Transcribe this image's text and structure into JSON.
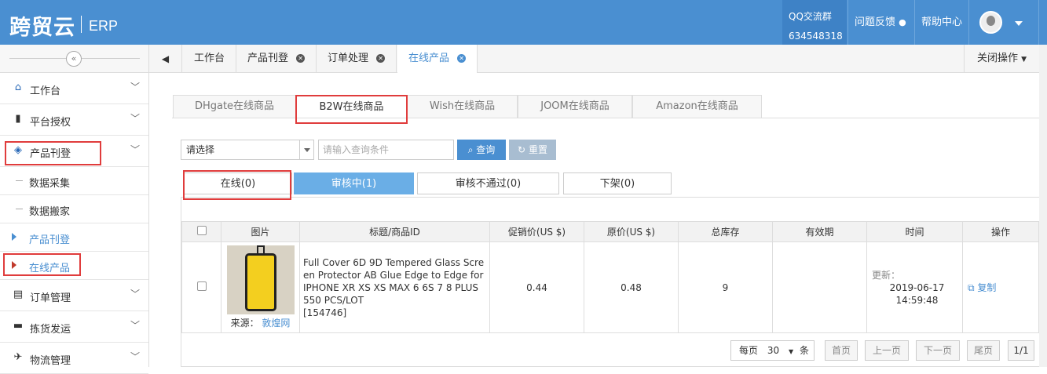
{
  "header": {
    "logo": "跨贸云",
    "product": "ERP",
    "qq_label": "QQ交流群",
    "qq_number": "634548318",
    "feedback": "问题反馈",
    "help": "帮助中心"
  },
  "sidebar": {
    "items": [
      {
        "label": "工作台"
      },
      {
        "label": "平台授权"
      },
      {
        "label": "产品刊登"
      },
      {
        "label": "数据采集"
      },
      {
        "label": "数据搬家"
      },
      {
        "label": "产品刊登"
      },
      {
        "label": "在线产品"
      },
      {
        "label": "订单管理"
      },
      {
        "label": "拣货发运"
      },
      {
        "label": "物流管理"
      }
    ]
  },
  "page_tabs": [
    {
      "label": "工作台"
    },
    {
      "label": "产品刊登"
    },
    {
      "label": "订单处理"
    },
    {
      "label": "在线产品"
    }
  ],
  "close_ops": "关闭操作",
  "platform_tabs": [
    "DHgate在线商品",
    "B2W在线商品",
    "Wish在线商品",
    "JOOM在线商品",
    "Amazon在线商品"
  ],
  "search": {
    "select_value": "请选择",
    "placeholder": "请输入查询条件",
    "query_label": "查询",
    "reset_label": "重置"
  },
  "status_tabs": [
    "在线(0)",
    "审核中(1)",
    "审核不通过(0)",
    "下架(0)"
  ],
  "table": {
    "headers": [
      "图片",
      "标题/商品ID",
      "促销价(US $)",
      "原价(US $)",
      "总库存",
      "有效期",
      "时间",
      "操作"
    ],
    "rows": [
      {
        "source_label": "来源：",
        "source_link": "敦煌网",
        "title": "Full Cover 6D 9D Tempered Glass Screen Protector AB Glue Edge to Edge for IPHONE XR XS XS MAX 6 6S 7 8 PLUS 550 PCS/LOT",
        "id": "[154746]",
        "promo_price": "0.44",
        "price": "0.48",
        "stock": "9",
        "validity": "",
        "time_label": "更新：",
        "time": "2019-06-17 14:59:48",
        "action": "复制"
      }
    ]
  },
  "pager": {
    "per_page_label": "每页",
    "per_page": "30",
    "unit": "条",
    "first": "首页",
    "prev": "上一页",
    "next": "下一页",
    "last": "尾页",
    "page": "1/1"
  },
  "colors": {
    "primary": "#4a8fd1",
    "highlight": "#e03c3c"
  }
}
